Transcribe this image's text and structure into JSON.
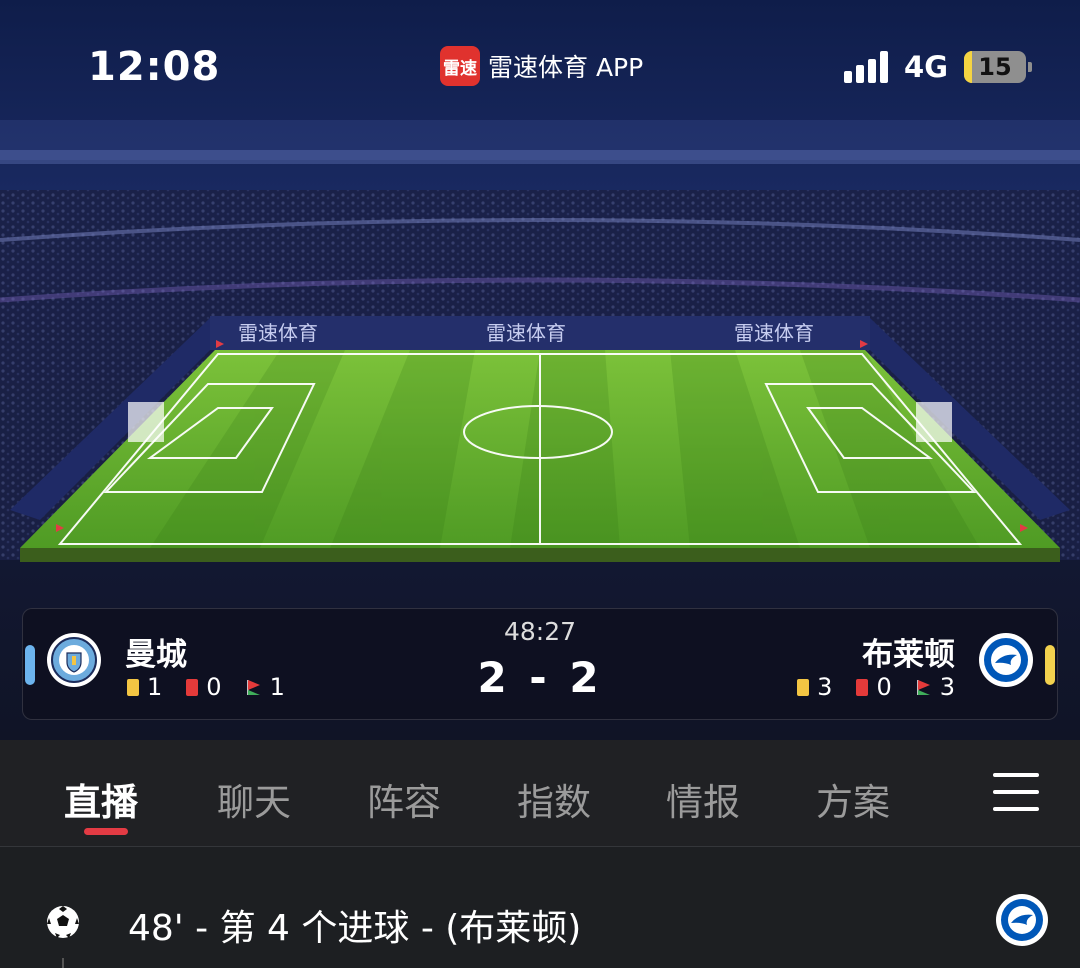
{
  "status_bar": {
    "time": "12:08",
    "app_logo_text": "雷速",
    "app_name": "雷速体育 APP",
    "network": "4G",
    "battery": "15"
  },
  "stadium": {
    "board_brand": "雷速体育",
    "pitch_color": "#56a82a",
    "sky_color": "#0d1a48"
  },
  "match": {
    "clock": "48:27",
    "score": "2 - 2",
    "home": {
      "name": "曼城",
      "yellow": "1",
      "red": "0",
      "corners": "1",
      "color": "#6cb4ee"
    },
    "away": {
      "name": "布莱顿",
      "yellow": "3",
      "red": "0",
      "corners": "3",
      "color": "#f2d14e"
    }
  },
  "tabs": [
    "直播",
    "聊天",
    "阵容",
    "指数",
    "情报",
    "方案"
  ],
  "active_tab": "直播",
  "events": [
    {
      "text": "48' - 第 4 个进球 - (布莱顿)",
      "icon": "soccer-ball-icon",
      "team": "away"
    }
  ]
}
